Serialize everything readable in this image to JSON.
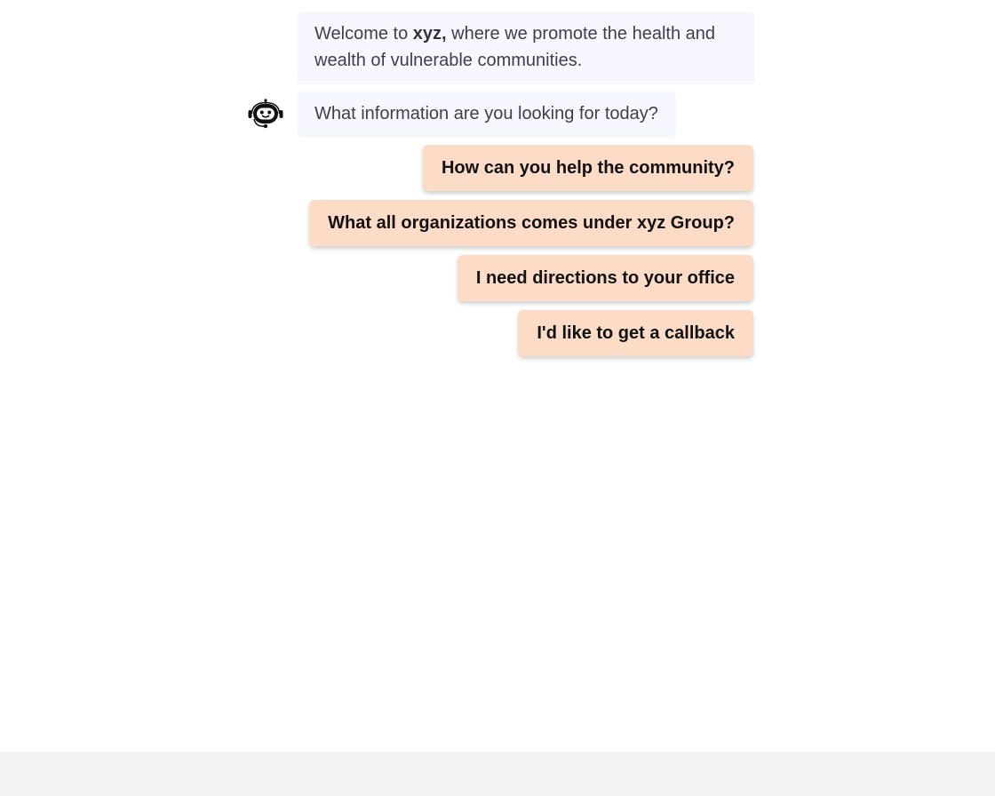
{
  "chat": {
    "welcome": {
      "prefix": "Welcome to ",
      "brand": "xyz,",
      "suffix": " where we promote the health and wealth of vulnerable communities."
    },
    "question": "What information are you looking for today?",
    "avatar_icon": "robot-headset-icon",
    "suggestions": [
      "How can you help the community?",
      "What all organizations comes under xyz Group?",
      "I need directions to your office",
      "I'd like to get a callback"
    ]
  },
  "colors": {
    "bot_bubble": "#f7f7ff",
    "suggestion_chip": "#fddcc7",
    "footer": "#f3f3f3"
  }
}
